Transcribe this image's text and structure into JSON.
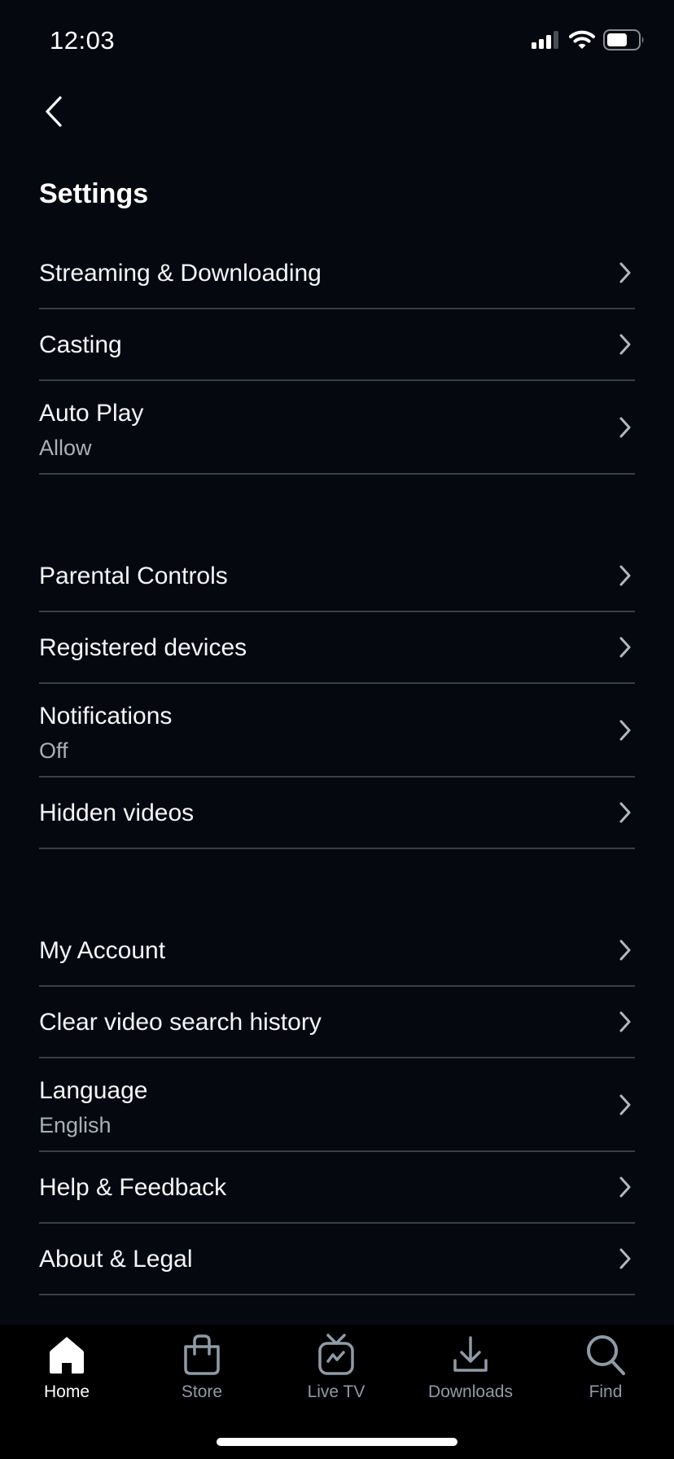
{
  "status_bar": {
    "time": "12:03",
    "icons": [
      "cellular-signal-icon",
      "wifi-icon",
      "battery-icon"
    ]
  },
  "header": {
    "back_icon": "chevron-left-icon",
    "title": "Settings"
  },
  "sections": [
    {
      "items": [
        {
          "label": "Streaming & Downloading",
          "value": null
        },
        {
          "label": "Casting",
          "value": null
        },
        {
          "label": "Auto Play",
          "value": "Allow"
        }
      ]
    },
    {
      "items": [
        {
          "label": "Parental Controls",
          "value": null
        },
        {
          "label": "Registered devices",
          "value": null
        },
        {
          "label": "Notifications",
          "value": "Off"
        },
        {
          "label": "Hidden videos",
          "value": null
        }
      ]
    },
    {
      "items": [
        {
          "label": "My Account",
          "value": null
        },
        {
          "label": "Clear video search history",
          "value": null
        },
        {
          "label": "Language",
          "value": "English"
        },
        {
          "label": "Help & Feedback",
          "value": null
        },
        {
          "label": "About & Legal",
          "value": null
        }
      ]
    }
  ],
  "tab_bar": {
    "active": "Home",
    "tabs": [
      {
        "label": "Home",
        "icon": "home-icon"
      },
      {
        "label": "Store",
        "icon": "shopping-bag-icon"
      },
      {
        "label": "Live TV",
        "icon": "live-tv-icon"
      },
      {
        "label": "Downloads",
        "icon": "download-icon"
      },
      {
        "label": "Find",
        "icon": "search-icon"
      }
    ]
  },
  "colors": {
    "background": "#05080f",
    "divider": "#3a3e46",
    "secondary_text": "#aab0b7",
    "tab_inactive": "#8f9ba6",
    "tab_active": "#ffffff"
  }
}
